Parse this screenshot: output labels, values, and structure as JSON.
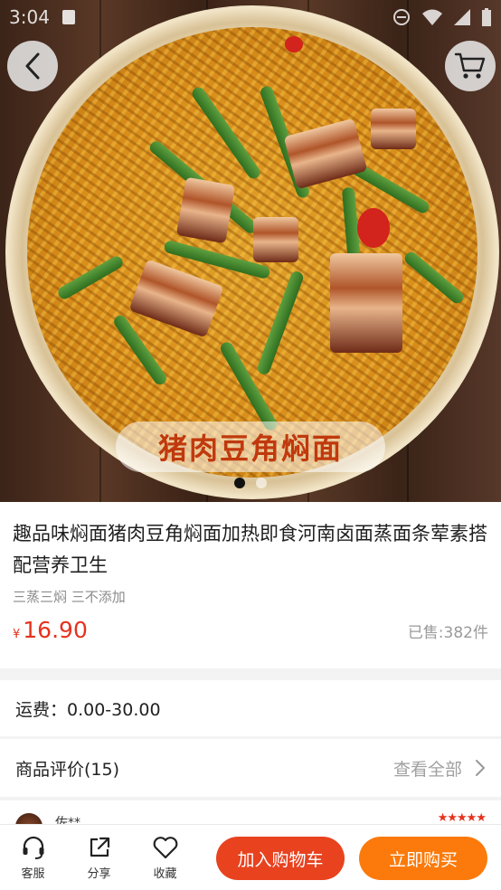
{
  "status_bar": {
    "time": "3:04"
  },
  "hero": {
    "banner_text": "猪肉豆角焖面",
    "slides": [
      "slide-1",
      "slide-2"
    ],
    "active_slide": 0
  },
  "product": {
    "title": "趣品味焖面猪肉豆角焖面加热即食河南卤面蒸面条荤素搭配营养卫生",
    "subtitle": "三蒸三焖 三不添加",
    "currency": "¥",
    "price": "16.90",
    "sold": "已售:382件"
  },
  "shipping": {
    "text": "运费：0.00-30.00"
  },
  "reviews": {
    "title": "商品评价(15)",
    "view_all": "查看全部",
    "preview_name": "佐**",
    "preview_stars": "★★★★★"
  },
  "bottom_bar": {
    "service": "客服",
    "share": "分享",
    "favorite": "收藏",
    "add_to_cart": "加入购物车",
    "buy_now": "立即购买"
  },
  "colors": {
    "accent_red": "#e5321d",
    "cart_button": "#e8421f",
    "buy_button": "#fb7a0b"
  }
}
